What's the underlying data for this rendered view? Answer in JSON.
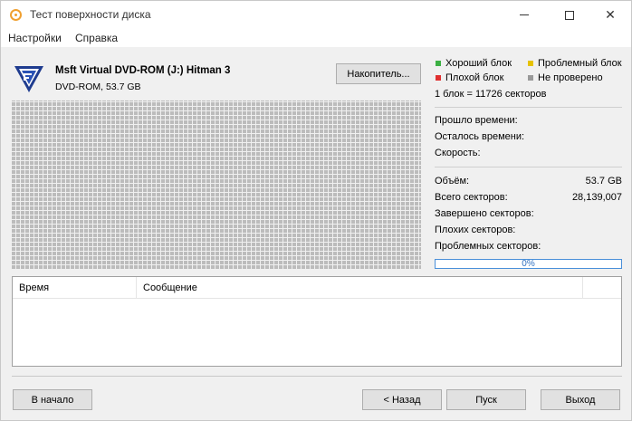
{
  "window": {
    "title": "Тест поверхности диска"
  },
  "menu": {
    "settings": "Настройки",
    "help": "Справка"
  },
  "drive": {
    "name": "Msft Virtual DVD-ROM (J:) Hitman 3",
    "subtitle": "DVD-ROM, 53.7 GB",
    "button_label": "Накопитель..."
  },
  "legend": {
    "good": "Хороший блок",
    "problem": "Проблемный блок",
    "bad": "Плохой блок",
    "unchecked": "Не проверено",
    "block_info": "1 блок = 11726 секторов",
    "colors": {
      "good": "#3cb043",
      "problem": "#e6c200",
      "bad": "#e03030",
      "unchecked": "#999999"
    }
  },
  "timing": {
    "elapsed_label": "Прошло времени:",
    "remaining_label": "Осталось времени:",
    "speed_label": "Скорость:"
  },
  "stats": {
    "volume_label": "Объём:",
    "volume_value": "53.7 GB",
    "total_sectors_label": "Всего секторов:",
    "total_sectors_value": "28,139,007",
    "completed_label": "Завершено секторов:",
    "bad_label": "Плохих секторов:",
    "problem_label": "Проблемных секторов:"
  },
  "progress": {
    "percent": 0,
    "text": "0%"
  },
  "log": {
    "col_time": "Время",
    "col_message": "Сообщение"
  },
  "buttons": {
    "start": "В начало",
    "back": "< Назад",
    "go": "Пуск",
    "exit": "Выход"
  }
}
